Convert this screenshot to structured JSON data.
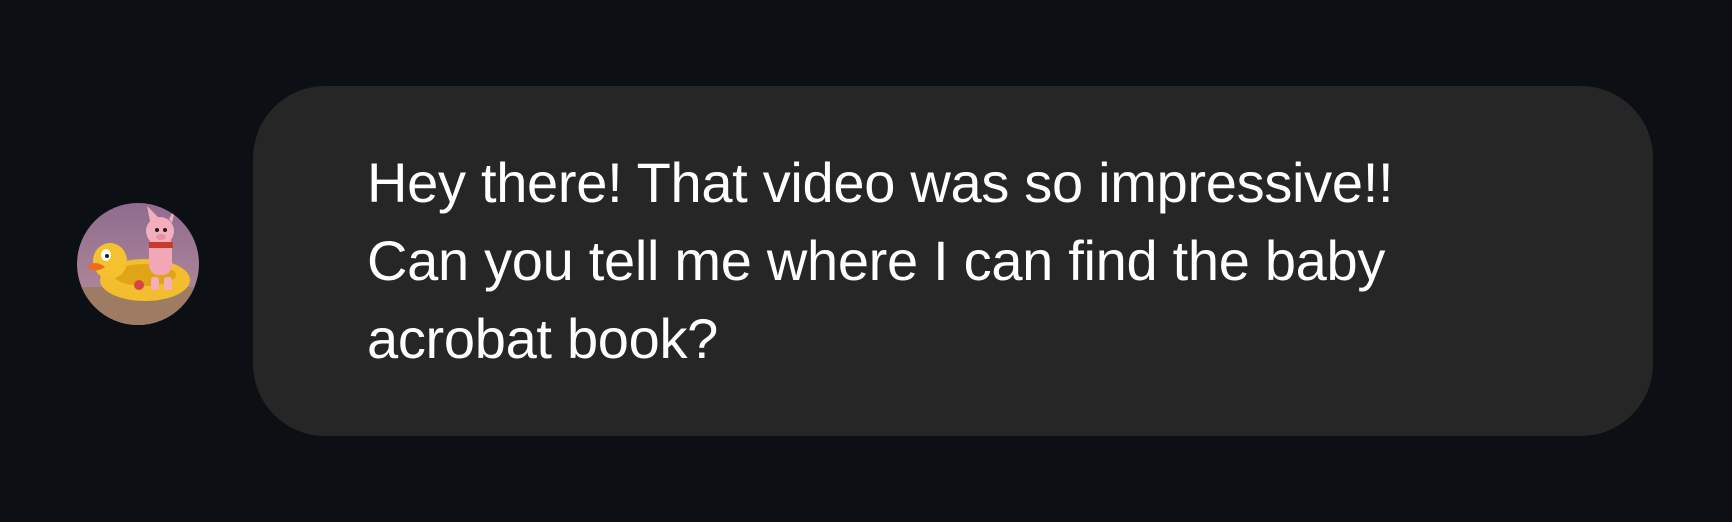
{
  "message": {
    "sender_avatar_icon": "cartoon-piglet-in-duck-float-avatar",
    "text": "Hey there! That video was so impressive!! Can you tell me where I can find the baby acrobat book?"
  },
  "colors": {
    "background": "#0c0f13",
    "bubble": "#262626",
    "text": "#ffffff"
  }
}
